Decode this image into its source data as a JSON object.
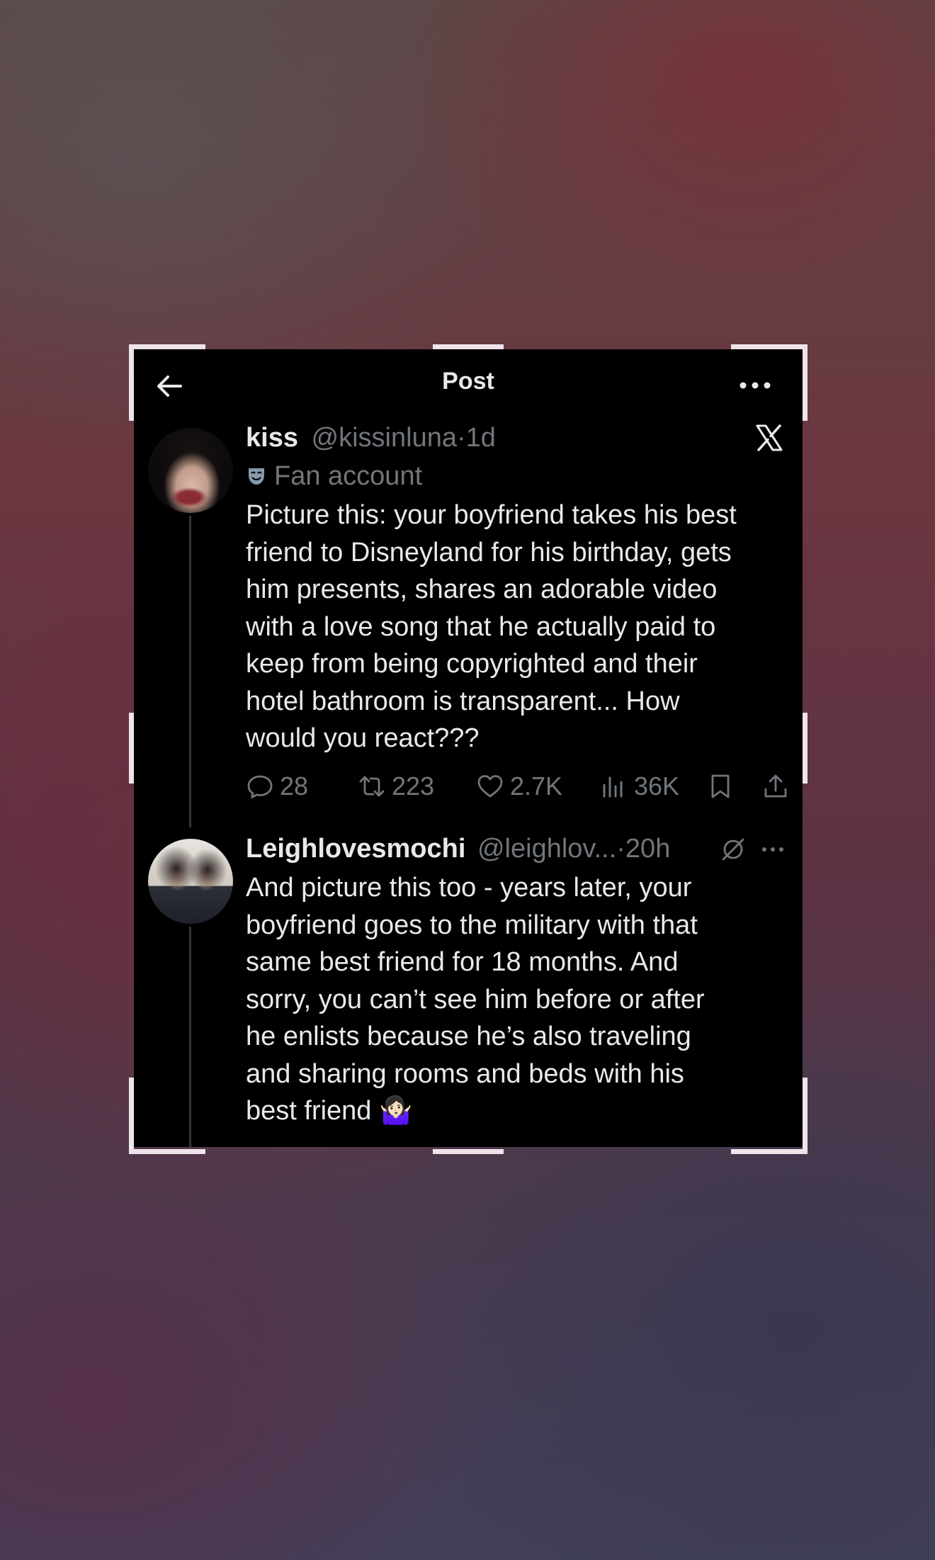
{
  "header": {
    "title": "Post"
  },
  "main_post": {
    "display_name": "kiss",
    "handle": "@kissinluna",
    "separator": "·",
    "time": "1d",
    "badge_label": "Fan account",
    "body": "Picture this: your boyfriend takes his best\nfriend to Disneyland for his birthday, gets\nhim presents, shares an adorable video\nwith a love song that he actually paid to\nkeep from being copyrighted and their\nhotel bathroom is transparent... How\nwould you react???",
    "stats": {
      "replies": "28",
      "reposts": "223",
      "likes": "2.7K",
      "views": "36K"
    }
  },
  "reply_post": {
    "display_name": "Leighlovesmochi",
    "handle": "@leighlov...",
    "separator": "·",
    "time": "20h",
    "body": "And picture this too - years later, your\nboyfriend goes to the military with that\nsame best friend for 18 months. And\nsorry, you can’t see him before or after\nhe enlists because he’s also traveling\nand sharing rooms and beds with his\nbest friend 🤷🏻‍♀️"
  },
  "icons": {
    "back": "arrow-left-icon",
    "more": "more-horizontal-icon",
    "brand": "x-logo-icon",
    "badge": "theater-mask-icon",
    "reply": "speech-bubble-icon",
    "repost": "repost-arrows-icon",
    "like": "heart-icon",
    "views": "bar-chart-icon",
    "bookmark": "bookmark-icon",
    "share": "share-upload-icon",
    "grok": "slashed-circle-icon"
  },
  "colors": {
    "card_background": "#000000",
    "primary_text": "#e7e9ea",
    "secondary_text": "#71767b",
    "thread_line": "#333639",
    "badge_accent": "#8899aa"
  }
}
